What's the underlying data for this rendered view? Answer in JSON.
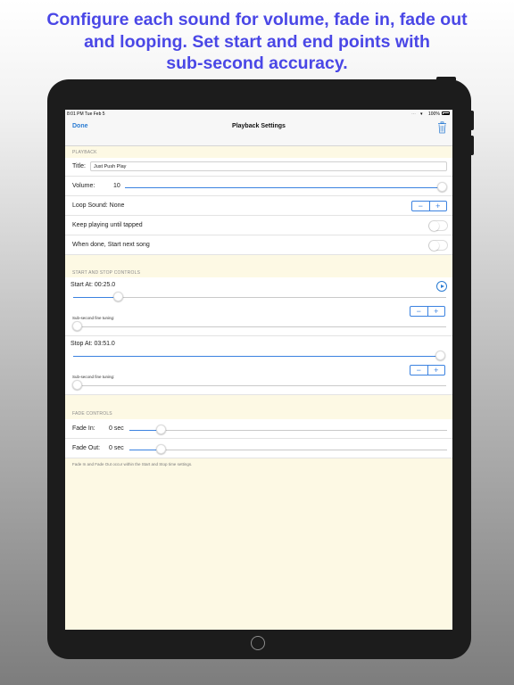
{
  "promo": {
    "line1": "Configure each sound for volume, fade in, fade out",
    "line2": "and looping.  Set start and end points with",
    "line3": "sub-second accuracy."
  },
  "status_bar": {
    "time": "8:01 PM   Tue Feb 5",
    "dots": "…",
    "wifi_icon": "▾",
    "battery": "100%"
  },
  "nav": {
    "done_label": "Done",
    "title": "Playback Settings",
    "trash_icon": "trash-icon"
  },
  "playback": {
    "header": "PLAYBACK",
    "title_label": "Title:",
    "title_value": "Just Push Play",
    "volume_label": "Volume:",
    "volume_value": "10",
    "volume_level": 1.0,
    "loop_label": "Loop Sound: None",
    "keep_playing_label": "Keep playing until tapped",
    "keep_playing_on": false,
    "when_done_label": "When done, Start next song",
    "when_done_on": false
  },
  "start_stop": {
    "header": "START AND STOP CONTROLS",
    "start_label": "Start At: 00:25.0",
    "start_level": 0.12,
    "fine_label": "Sub-second fine tuning:",
    "start_fine_level": 0.0,
    "stop_label": "Stop At: 03:51.0",
    "stop_level": 1.0,
    "stop_fine_level": 0.0
  },
  "fade": {
    "header": "FADE CONTROLS",
    "fade_in_label": "Fade In:",
    "fade_in_value": "0 sec",
    "fade_in_level": 0.1,
    "fade_out_label": "Fade Out:",
    "fade_out_value": "0 sec",
    "fade_out_level": 0.1,
    "footnote": "Fade In and Fade Out occur within the Start and Stop time settings."
  },
  "stepper": {
    "minus": "−",
    "plus": "+"
  },
  "colors": {
    "accent": "#3b82e0",
    "headline": "#4a47e6",
    "screen_background": "#fdf9e4"
  }
}
